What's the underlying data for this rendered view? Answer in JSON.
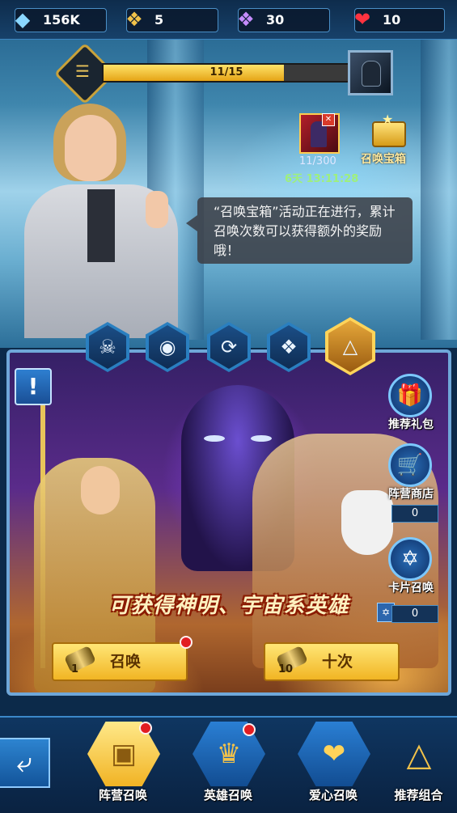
{
  "resources": [
    {
      "icon": "diamond-icon",
      "value": "156K"
    },
    {
      "icon": "scroll-icon",
      "value": "5"
    },
    {
      "icon": "purple-scroll-icon",
      "value": "30"
    },
    {
      "icon": "heart-icon",
      "value": "10"
    }
  ],
  "progress": {
    "text": "11/15",
    "fraction": 0.733
  },
  "chest": {
    "count": "11/300",
    "time": "6天 13:11:28",
    "label": "召唤宝箱"
  },
  "bubble": {
    "text": "“召唤宝箱”活动正在进行，累计召唤次数可以获得额外的奖励哦！"
  },
  "panel": {
    "info_label": "!",
    "banner": "可获得神明、宇宙系英雄",
    "side": {
      "gift_label": "推荐礼包",
      "shop_label": "阵营商店",
      "shop_count": "0",
      "card_label": "卡片召唤",
      "card_count": "0"
    },
    "summon_one": {
      "qty": "1",
      "label": "召唤"
    },
    "summon_ten": {
      "qty": "10",
      "label": "十次"
    }
  },
  "tabs": [
    {
      "icon": "skull-icon"
    },
    {
      "icon": "mask-icon"
    },
    {
      "icon": "swirl-icon"
    },
    {
      "icon": "wolf-icon"
    },
    {
      "icon": "triangle-star-icon",
      "active": true
    }
  ],
  "nav": {
    "faction": "阵营召唤",
    "hero": "英雄召唤",
    "love": "爱心召唤",
    "combo": "推荐组合"
  },
  "colors": {
    "accent": "#f1b524",
    "panel_border": "#6fa7d9",
    "badge": "#e21d22"
  }
}
